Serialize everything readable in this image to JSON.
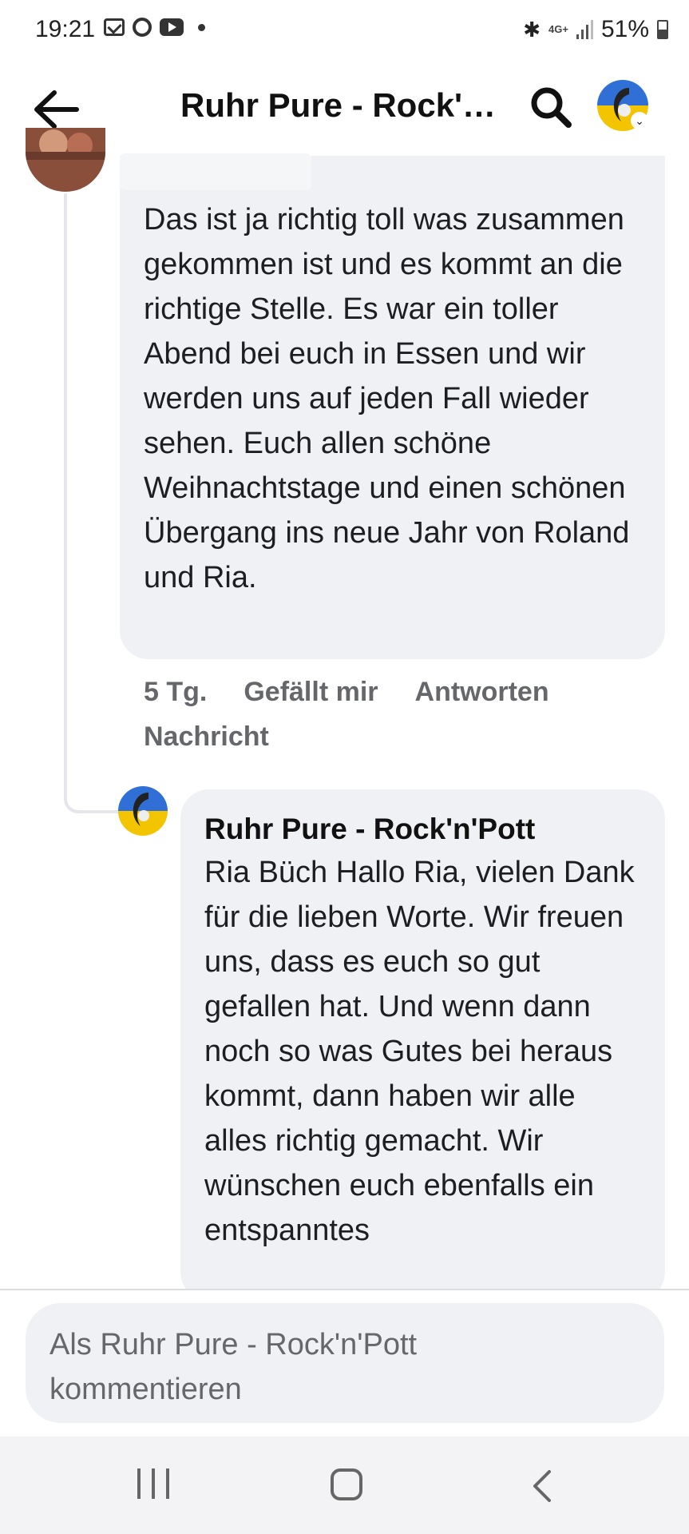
{
  "status_bar": {
    "time": "19:21",
    "network": "4G+",
    "battery": "51%",
    "icons": [
      "mail-icon",
      "ring-icon",
      "youtube-icon",
      "dot-icon",
      "bluetooth-icon",
      "signal-icon",
      "battery-icon"
    ]
  },
  "header": {
    "title": "Ruhr Pure - Rock'n'Pott",
    "back_icon": "back-arrow-icon",
    "search_icon": "search-icon"
  },
  "comments": [
    {
      "text": "Das ist ja richtig toll was zusammen gekommen ist und es kommt an die richtige Stelle. Es war ein toller Abend bei euch in Essen und wir werden uns auf jeden Fall wieder sehen. Euch allen schöne Weihnachtstage und einen schönen Übergang ins neue Jahr von Roland und Ria.",
      "time": "5 Tg.",
      "like": "Gefällt mir",
      "reply": "Antworten",
      "message": "Nachricht"
    },
    {
      "author": "Ruhr Pure - Rock'n'Pott",
      "text": "Ria Büch Hallo Ria, vielen Dank für die lieben Worte. Wir freuen uns, dass es euch so gut gefallen hat. Und wenn dann noch so was Gutes bei heraus kommt, dann haben wir alle alles richtig gemacht. Wir wünschen euch ebenfalls ein entspanntes"
    }
  ],
  "composer": {
    "placeholder": "Als Ruhr Pure - Rock'n'Pott kommentieren"
  },
  "colors": {
    "bubble": "#f0f1f5",
    "meta_text": "#65676b",
    "text": "#1c1e21"
  }
}
